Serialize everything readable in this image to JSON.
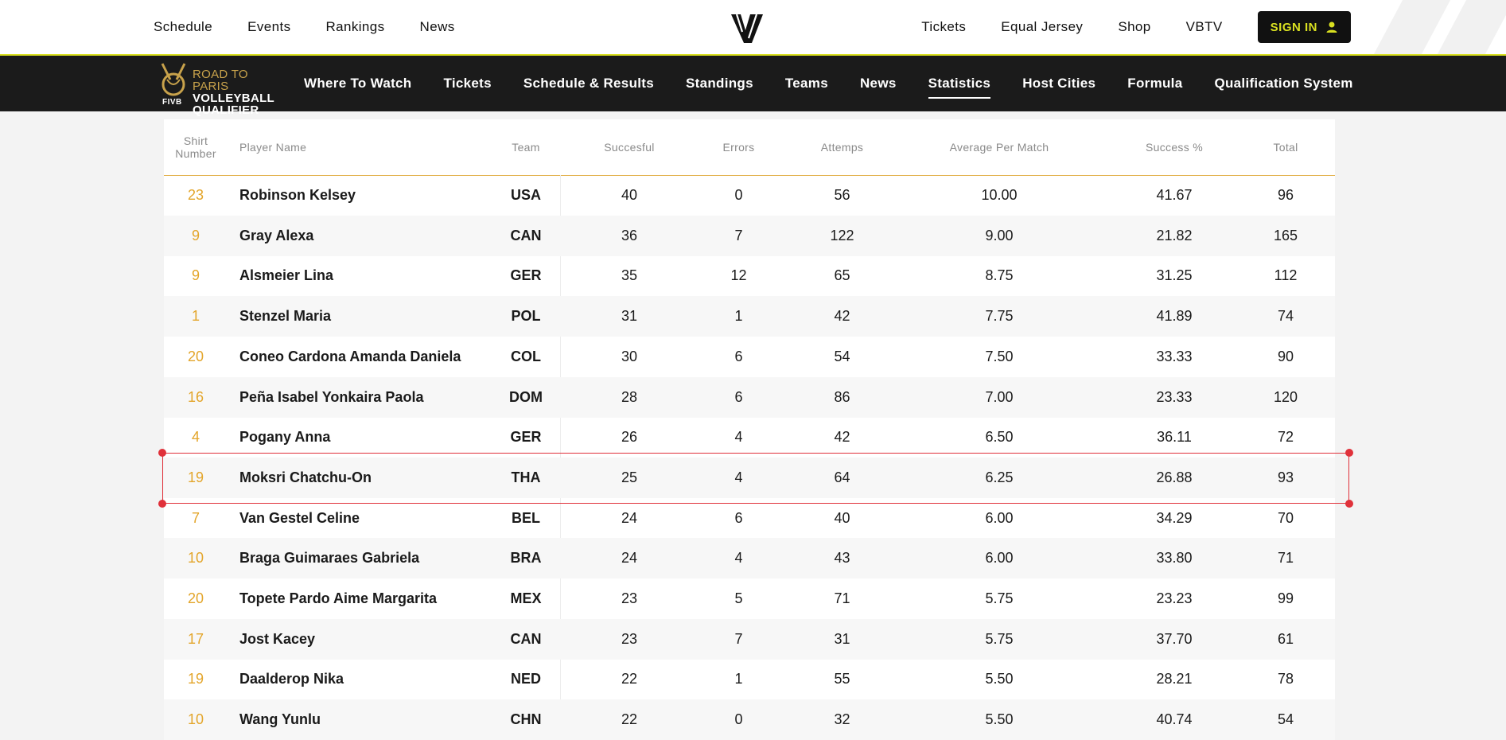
{
  "top_nav": {
    "left": [
      "Schedule",
      "Events",
      "Rankings",
      "News"
    ],
    "right": [
      "Tickets",
      "Equal Jersey",
      "Shop",
      "VBTV"
    ],
    "sign_in": "SIGN IN",
    "logo_icon": "vnl-logo-icon",
    "person_icon": "person-icon"
  },
  "brand": {
    "line1": "ROAD TO PARIS",
    "line2": "VOLLEYBALL",
    "line3": "QUALIFIER",
    "mark": "FIVB"
  },
  "sub_nav": {
    "items": [
      "Where To Watch",
      "Tickets",
      "Schedule & Results",
      "Standings",
      "Teams",
      "News",
      "Statistics",
      "Host Cities",
      "Formula",
      "Qualification System"
    ],
    "active": "Statistics"
  },
  "table": {
    "headers": {
      "shirt": "Shirt\nNumber",
      "name": "Player Name",
      "team": "Team",
      "successful": "Succesful",
      "errors": "Errors",
      "attempts": "Attemps",
      "avg": "Average Per Match",
      "success_pct": "Success %",
      "total": "Total"
    },
    "rows": [
      {
        "num": "23",
        "name": "Robinson Kelsey",
        "team": "USA",
        "s": "40",
        "e": "0",
        "a": "56",
        "avg": "10.00",
        "pct": "41.67",
        "total": "96"
      },
      {
        "num": "9",
        "name": "Gray Alexa",
        "team": "CAN",
        "s": "36",
        "e": "7",
        "a": "122",
        "avg": "9.00",
        "pct": "21.82",
        "total": "165"
      },
      {
        "num": "9",
        "name": "Alsmeier Lina",
        "team": "GER",
        "s": "35",
        "e": "12",
        "a": "65",
        "avg": "8.75",
        "pct": "31.25",
        "total": "112"
      },
      {
        "num": "1",
        "name": "Stenzel Maria",
        "team": "POL",
        "s": "31",
        "e": "1",
        "a": "42",
        "avg": "7.75",
        "pct": "41.89",
        "total": "74"
      },
      {
        "num": "20",
        "name": "Coneo Cardona Amanda Daniela",
        "team": "COL",
        "s": "30",
        "e": "6",
        "a": "54",
        "avg": "7.50",
        "pct": "33.33",
        "total": "90"
      },
      {
        "num": "16",
        "name": "Peña Isabel Yonkaira Paola",
        "team": "DOM",
        "s": "28",
        "e": "6",
        "a": "86",
        "avg": "7.00",
        "pct": "23.33",
        "total": "120"
      },
      {
        "num": "4",
        "name": "Pogany Anna",
        "team": "GER",
        "s": "26",
        "e": "4",
        "a": "42",
        "avg": "6.50",
        "pct": "36.11",
        "total": "72"
      },
      {
        "num": "19",
        "name": "Moksri Chatchu-On",
        "team": "THA",
        "s": "25",
        "e": "4",
        "a": "64",
        "avg": "6.25",
        "pct": "26.88",
        "total": "93"
      },
      {
        "num": "7",
        "name": "Van Gestel Celine",
        "team": "BEL",
        "s": "24",
        "e": "6",
        "a": "40",
        "avg": "6.00",
        "pct": "34.29",
        "total": "70"
      },
      {
        "num": "10",
        "name": "Braga Guimaraes Gabriela",
        "team": "BRA",
        "s": "24",
        "e": "4",
        "a": "43",
        "avg": "6.00",
        "pct": "33.80",
        "total": "71"
      },
      {
        "num": "20",
        "name": "Topete Pardo Aime Margarita",
        "team": "MEX",
        "s": "23",
        "e": "5",
        "a": "71",
        "avg": "5.75",
        "pct": "23.23",
        "total": "99"
      },
      {
        "num": "17",
        "name": "Jost Kacey",
        "team": "CAN",
        "s": "23",
        "e": "7",
        "a": "31",
        "avg": "5.75",
        "pct": "37.70",
        "total": "61"
      },
      {
        "num": "19",
        "name": "Daalderop Nika",
        "team": "NED",
        "s": "22",
        "e": "1",
        "a": "55",
        "avg": "5.50",
        "pct": "28.21",
        "total": "78"
      },
      {
        "num": "10",
        "name": "Wang Yunlu",
        "team": "CHN",
        "s": "22",
        "e": "0",
        "a": "32",
        "avg": "5.50",
        "pct": "40.74",
        "total": "54"
      }
    ],
    "highlighted_row_index": 7
  },
  "colors": {
    "accent_gold": "#e3a52a",
    "brand_yellow": "#d9e021",
    "highlight_red": "#e0313a",
    "dark_bar": "#1b1b1b"
  }
}
